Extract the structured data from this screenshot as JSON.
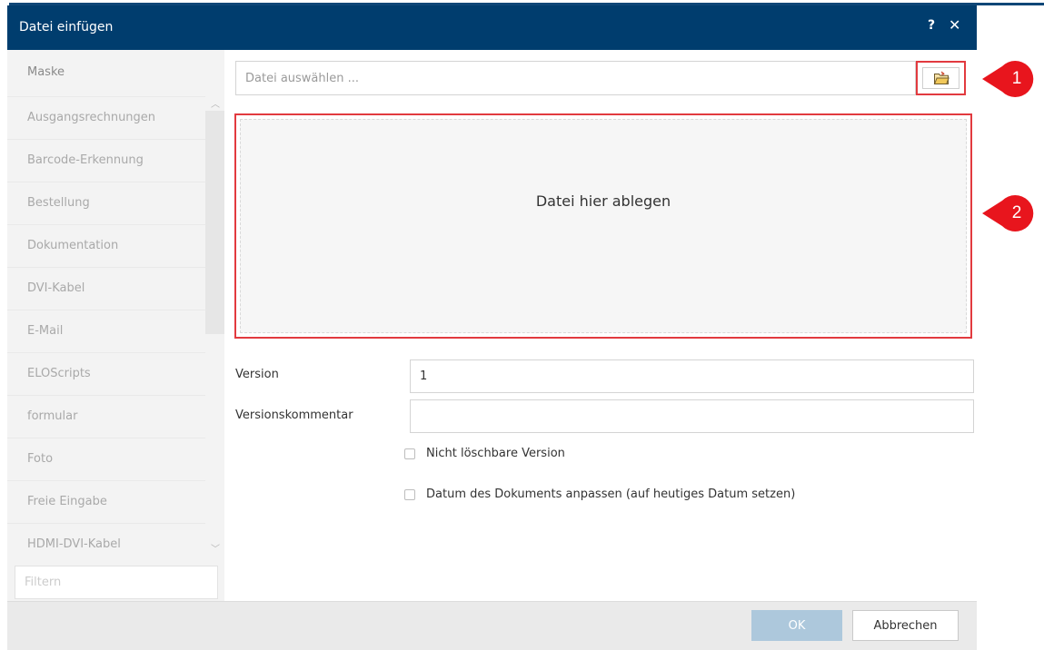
{
  "dialog": {
    "title": "Datei einfügen",
    "help_label": "?",
    "close_label": "✕"
  },
  "sidebar": {
    "header": "Maske",
    "items": [
      {
        "label": "Ausgangsrechnungen"
      },
      {
        "label": "Barcode-Erkennung"
      },
      {
        "label": "Bestellung"
      },
      {
        "label": "Dokumentation"
      },
      {
        "label": "DVI-Kabel"
      },
      {
        "label": "E-Mail"
      },
      {
        "label": "ELOScripts"
      },
      {
        "label": "formular"
      },
      {
        "label": "Foto"
      },
      {
        "label": "Freie Eingabe"
      },
      {
        "label": "HDMI-DVI-Kabel"
      }
    ],
    "filter_placeholder": "Filtern"
  },
  "file": {
    "placeholder": "Datei auswählen ...",
    "value": "",
    "browse_icon": "folder-open-icon"
  },
  "dropzone": {
    "text": "Datei hier ablegen"
  },
  "form": {
    "version_label": "Version",
    "version_value": "1",
    "comment_label": "Versionskommentar",
    "comment_value": "",
    "checkbox_1_label": "Nicht löschbare Version",
    "checkbox_1_checked": false,
    "checkbox_2_label": "Datum des Dokuments anpassen (auf heutiges Datum setzen)",
    "checkbox_2_checked": false
  },
  "footer": {
    "ok_label": "OK",
    "cancel_label": "Abbrechen"
  },
  "callouts": {
    "one": "1",
    "two": "2"
  },
  "colors": {
    "title_bar": "#003d6e",
    "highlight": "#e23a3f",
    "ok_disabled": "#adc8dc"
  }
}
